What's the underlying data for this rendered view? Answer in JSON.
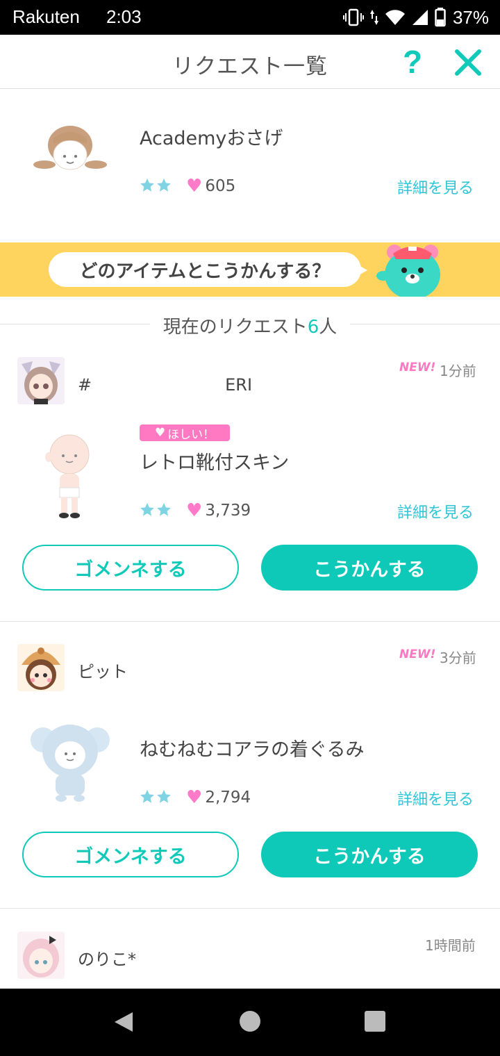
{
  "status_bar": {
    "carrier": "Rakuten",
    "time": "2:03",
    "battery": "37%"
  },
  "header": {
    "title": "リクエスト一覧",
    "help_label": "?"
  },
  "item": {
    "name": "Academyおさげ",
    "stars": 2,
    "likes": "605",
    "details_label": "詳細を見る"
  },
  "banner": {
    "text": "どのアイテムとこうかんする？"
  },
  "section": {
    "title_prefix": "現在のリクエスト",
    "count": "6",
    "title_suffix": "人"
  },
  "requests": [
    {
      "username": "#　　　　　　　　ERI",
      "new_label": "NEW!",
      "time_ago": "1分前",
      "want_label": "ほしい！",
      "item_name": "レトロ靴付スキン",
      "stars": 2,
      "likes": "3,739",
      "details_label": "詳細を見る",
      "decline_label": "ゴメンネする",
      "exchange_label": "こうかんする"
    },
    {
      "username": "ピット",
      "new_label": "NEW!",
      "time_ago": "3分前",
      "item_name": "ねむねむコアラの着ぐるみ",
      "stars": 2,
      "likes": "2,794",
      "details_label": "詳細を見る",
      "decline_label": "ゴメンネする",
      "exchange_label": "こうかんする"
    },
    {
      "username": "のりこ*",
      "time_ago": "1時間前"
    }
  ],
  "colors": {
    "accent": "#0fc9b8",
    "link": "#2cc6d6",
    "pink": "#ff78c2",
    "banner": "#ffd45e"
  }
}
